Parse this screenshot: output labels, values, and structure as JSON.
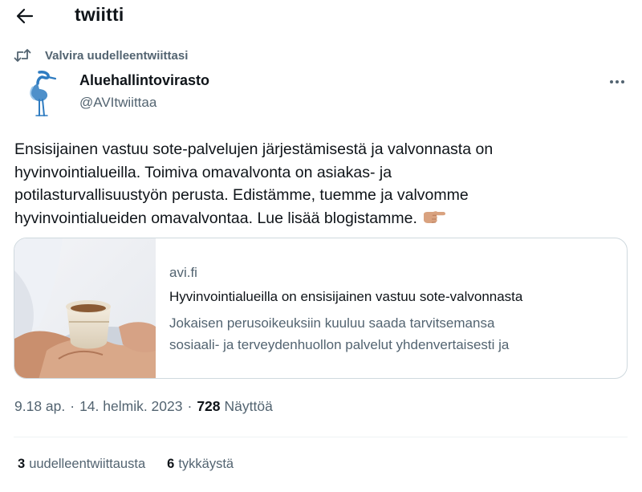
{
  "header": {
    "title": "twiitti",
    "back_icon": "arrow-left-icon"
  },
  "retweet_context": {
    "icon": "retweet-icon",
    "label": "Valvira uudelleentwiittasi"
  },
  "author": {
    "name": "Aluehallintovirasto",
    "handle": "@AVItwiittaa",
    "avatar_icon": "heron-logo-icon"
  },
  "tweet": {
    "lines": [
      "Ensisijainen vastuu sote-palvelujen järjestämisestä ja valvonnasta on",
      "hyvinvointialueilla. Toimiva omavalvonta on asiakas- ja",
      "potilasturvallisuustyön perusta. Edistämme, tuemme ja valvomme",
      "hyvinvointialueiden omavalvontaa. Lue lisää blogistamme."
    ],
    "emoji": "backhand-index-pointing-right"
  },
  "link_card": {
    "domain": "avi.fi",
    "title": "Hyvinvointialueilla on ensisijainen vastuu sote-valvonnasta",
    "description_lines": [
      "Jokaisen perusoikeuksiin kuuluu saada tarvitsemansa",
      "sosiaali- ja terveydenhuollon palvelut yhdenvertaisesti ja"
    ]
  },
  "meta": {
    "time": "9.18 ap.",
    "separator": "·",
    "date": "14. helmik. 2023",
    "views_count": "728",
    "views_label": "Näyttöä"
  },
  "stats": {
    "retweets_count": "3",
    "retweets_label": "uudelleentwiittausta",
    "likes_count": "6",
    "likes_label": "tykkäystä"
  },
  "colors": {
    "text_primary": "#0f1419",
    "text_secondary": "#536471",
    "border": "#cfd9de",
    "logo_blue": "#2f7cc1"
  }
}
